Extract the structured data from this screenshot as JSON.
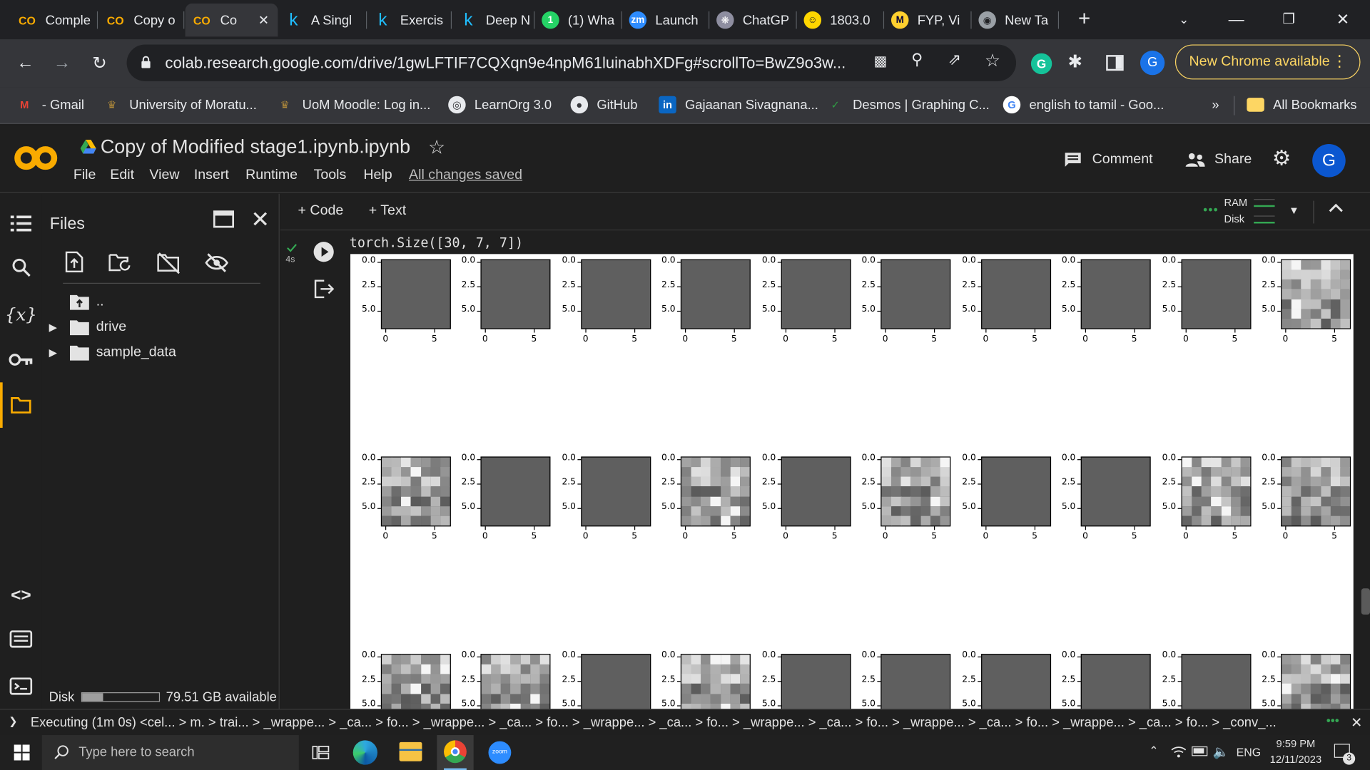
{
  "browser": {
    "tabs": [
      {
        "label": "Comple",
        "icon": "colab-icon"
      },
      {
        "label": "Copy o",
        "icon": "colab-icon"
      },
      {
        "label": "Co",
        "icon": "colab-icon"
      },
      {
        "label": "A Singl",
        "icon": "kaggle-icon"
      },
      {
        "label": "Exercis",
        "icon": "kaggle-icon"
      },
      {
        "label": "Deep N",
        "icon": "kaggle-icon"
      },
      {
        "label": "(1) Wha",
        "icon": "whatsapp-icon"
      },
      {
        "label": "Launch",
        "icon": "zoom-icon"
      },
      {
        "label": "ChatGP",
        "icon": "chatgpt-icon"
      },
      {
        "label": "1803.0",
        "icon": "smiley-icon"
      },
      {
        "label": "FYP, Vi",
        "icon": "miro-icon"
      },
      {
        "label": "New Ta",
        "icon": "chrome-icon"
      }
    ],
    "url": "colab.research.google.com/drive/1gwLFTIF7CQXqn9e4npM61luinabhXDFg#scrollTo=BwZ9o3w...",
    "profile_letter": "G",
    "new_chrome": "New Chrome available",
    "bookmarks": [
      {
        "label": "- Gmail",
        "icon": "gmail-icon"
      },
      {
        "label": "University of Moratu...",
        "icon": "uom-icon"
      },
      {
        "label": "UoM Moodle: Log in...",
        "icon": "uom-icon"
      },
      {
        "label": "LearnOrg 3.0",
        "icon": "globe-icon"
      },
      {
        "label": "GitHub",
        "icon": "github-icon"
      },
      {
        "label": "Gajaanan Sivagnana...",
        "icon": "linkedin-icon"
      },
      {
        "label": "Desmos | Graphing C...",
        "icon": "desmos-icon"
      },
      {
        "label": "english to tamil - Goo...",
        "icon": "google-icon"
      }
    ],
    "more_bookmarks": "»",
    "all_bookmarks": "All Bookmarks"
  },
  "colab": {
    "notebook_title": "Copy of Modified stage1.ipynb.ipynb",
    "menu": [
      "File",
      "Edit",
      "View",
      "Insert",
      "Runtime",
      "Tools",
      "Help"
    ],
    "save_status": "All changes saved",
    "comment_label": "Comment",
    "share_label": "Share",
    "avatar_letter": "G",
    "add_code": "+ Code",
    "add_text": "+ Text",
    "ram_label": "RAM",
    "disk_label": "Disk"
  },
  "files_panel": {
    "title": "Files",
    "items": [
      {
        "label": ".."
      },
      {
        "label": "drive"
      },
      {
        "label": "sample_data"
      }
    ],
    "disk_label": "Disk",
    "disk_available": "79.51 GB available",
    "disk_used_fraction": 0.27
  },
  "cell": {
    "exec_time": "4s",
    "output_text": "torch.Size([30, 7, 7])",
    "y_ticks": [
      "0.0",
      "2.5",
      "5.0"
    ],
    "x_ticks": [
      "0",
      "5"
    ],
    "rows": [
      [
        "flat",
        "flat",
        "flat",
        "flat",
        "flat",
        "flat",
        "flat",
        "flat",
        "flat",
        "textured"
      ],
      [
        "textured",
        "flat",
        "flat",
        "textured",
        "flat",
        "textured",
        "flat",
        "flat",
        "textured",
        "textured"
      ],
      [
        "textured",
        "textured",
        "flat",
        "textured",
        "flat",
        "flat",
        "flat",
        "flat",
        "flat",
        "textured"
      ]
    ]
  },
  "statusbar": {
    "text": "Executing (1m 0s)  <cel...  >  m.  >  trai...  >  _wrappe...  >  _ca...  >  fo...  >  _wrappe...  >  _ca...  >  fo...  >  _wrappe...  >  _ca...  >  fo...  >  _wrappe...  >  _ca...  >  fo...  >  _wrappe...  >  _ca...  >  fo...  >  _wrappe...  >  _ca...  >  fo...  >  _conv_..."
  },
  "taskbar": {
    "search_placeholder": "Type here to search",
    "language": "ENG",
    "time": "9:59 PM",
    "date": "12/11/2023",
    "notifications": "3"
  }
}
